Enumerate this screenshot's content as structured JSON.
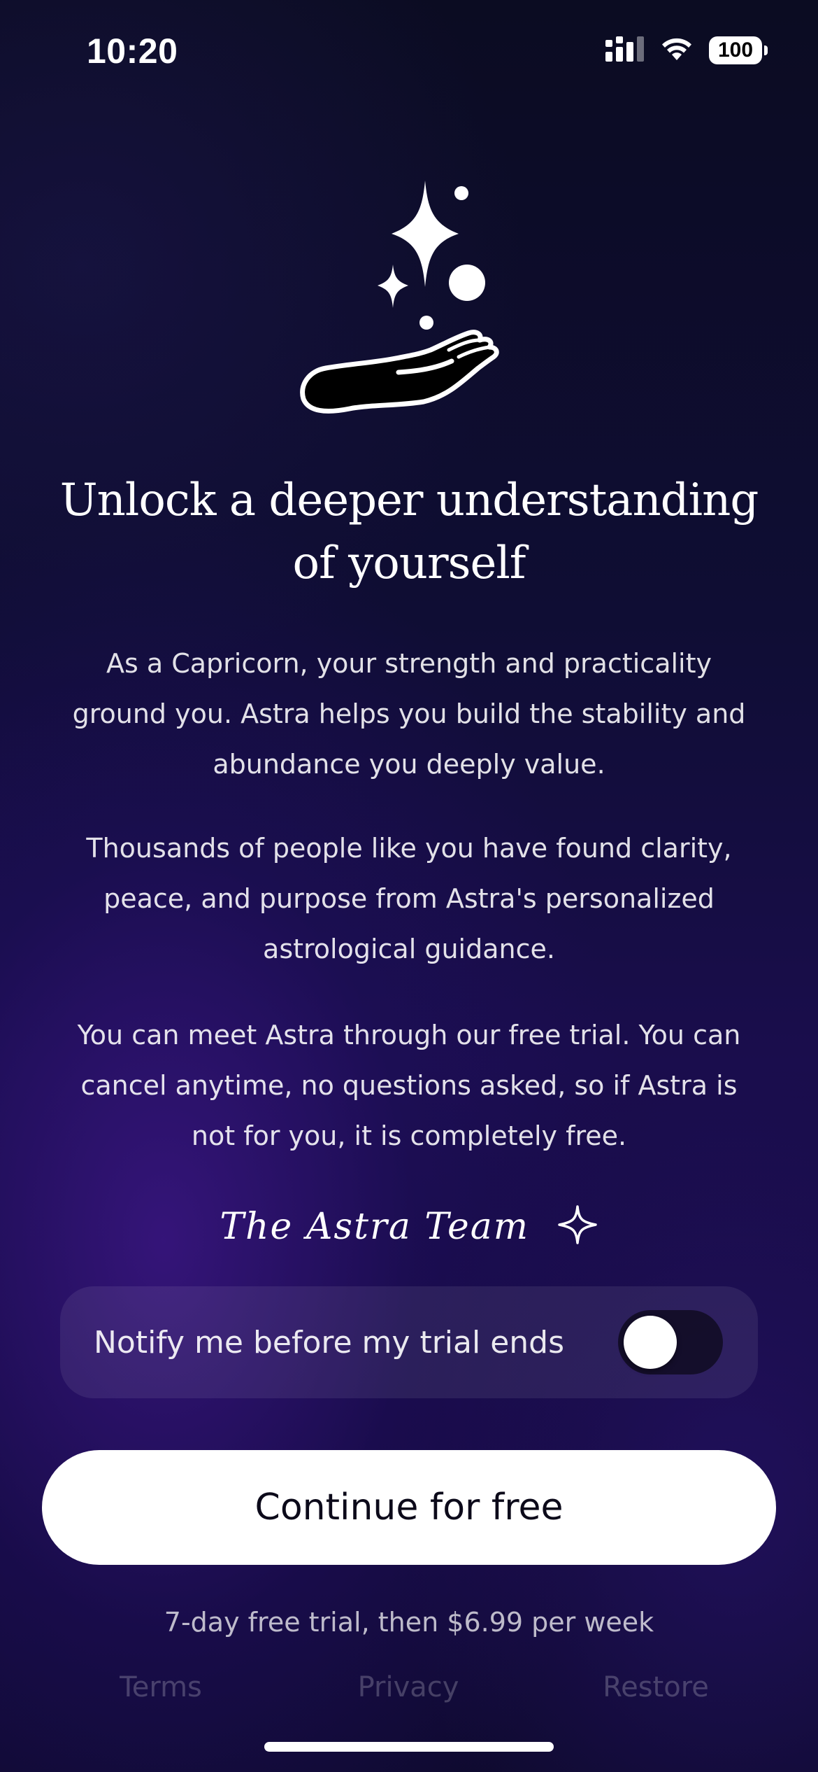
{
  "status_bar": {
    "time": "10:20",
    "battery": "100",
    "icons": [
      "cellular-signal-icon",
      "wifi-icon",
      "battery-icon"
    ]
  },
  "hero": {
    "icons": [
      "sparkle-star-icon",
      "open-hand-icon"
    ]
  },
  "headline": {
    "line1": "Unlock a deeper understanding",
    "line2": "of yourself"
  },
  "paragraphs": [
    "As a Capricorn, your strength and practicality ground you. Astra helps you build the stability and abundance you deeply value.",
    "Thousands of people like you have found clarity, peace, and purpose from Astra's personalized astrological guidance.",
    "You can meet Astra through our free trial. You can cancel anytime, no questions asked, so if Astra is not for you, it is completely free."
  ],
  "signature": "The Astra Team",
  "notify": {
    "label": "Notify me before my trial ends",
    "enabled": false
  },
  "cta": {
    "label": "Continue for free"
  },
  "trial_note": "7-day free trial, then $6.99 per week",
  "footer": {
    "terms": "Terms",
    "privacy": "Privacy",
    "restore": "Restore"
  },
  "colors": {
    "background_top": "#0b0c22",
    "background_mid": "#1a0d4d",
    "cta_background": "#ffffff",
    "cta_text": "#0c0a1a"
  }
}
